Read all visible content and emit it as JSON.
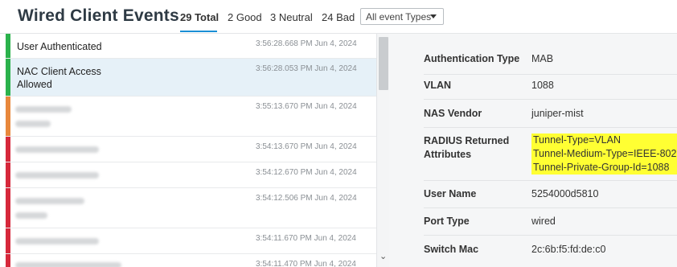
{
  "header": {
    "title": "Wired Client Events",
    "tabs": {
      "total": "29 Total",
      "good": "2 Good",
      "neutral": "3 Neutral",
      "bad": "24 Bad"
    },
    "filter_value": "All event Types"
  },
  "events": [
    {
      "name": "User Authenticated",
      "time": "3:56:28.668 PM Jun 4, 2024",
      "status_color": "#2bb24c"
    },
    {
      "name_line1": "NAC Client Access",
      "name_line2": "Allowed",
      "time": "3:56:28.053 PM Jun 4, 2024",
      "status_color": "#2bb24c"
    },
    {
      "time": "3:55:13.670 PM Jun 4, 2024",
      "status_color": "#e8883c"
    },
    {
      "time": "3:54:13.670 PM Jun 4, 2024",
      "status_color": "#d6283b"
    },
    {
      "time": "3:54:12.670 PM Jun 4, 2024",
      "status_color": "#d6283b"
    },
    {
      "time": "3:54:12.506 PM Jun 4, 2024",
      "status_color": "#d6283b"
    },
    {
      "time": "3:54:11.670 PM Jun 4, 2024",
      "status_color": "#d6283b"
    },
    {
      "time": "3:54:11.470 PM Jun 4, 2024",
      "status_color": "#d6283b"
    }
  ],
  "details": {
    "auth_type": {
      "label": "Authentication Type",
      "value": "MAB"
    },
    "vlan": {
      "label": "VLAN",
      "value": "1088"
    },
    "nas_vendor": {
      "label": "NAS Vendor",
      "value": "juniper-mist"
    },
    "radius": {
      "label_line1": "RADIUS Returned",
      "label_line2": "Attributes",
      "values": [
        "Tunnel-Type=VLAN",
        "Tunnel-Medium-Type=IEEE-802",
        "Tunnel-Private-Group-Id=1088"
      ]
    },
    "user_name": {
      "label": "User Name",
      "value": "5254000d5810"
    },
    "port_type": {
      "label": "Port Type",
      "value": "wired"
    },
    "switch_mac": {
      "label": "Switch Mac",
      "value": "2c:6b:f5:fd:de:c0"
    }
  }
}
